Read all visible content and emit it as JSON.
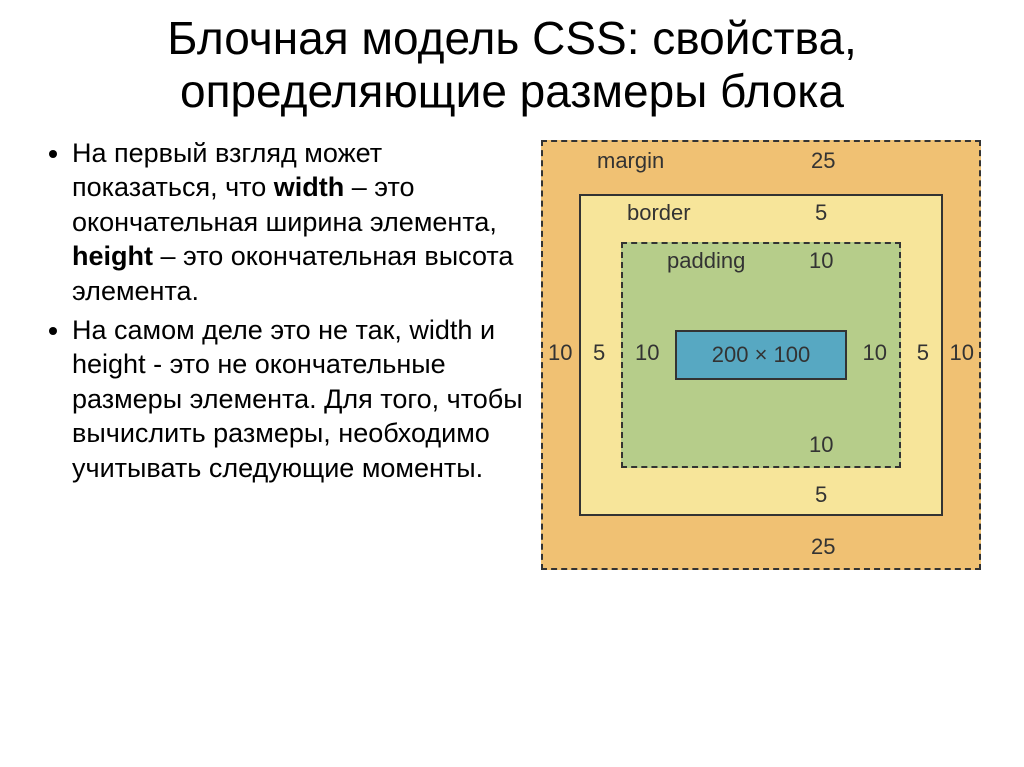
{
  "title": "Блочная модель CSS: свойства, определяющие размеры блока",
  "bullets": {
    "b1a": "На первый взгляд может показаться, что ",
    "b1_width": "width",
    "b1b": " – это окончательная ширина элемента, ",
    "b1_height": "height",
    "b1c": " – это окончательная высота элемента.",
    "b2a": "На самом деле это не так, ",
    "b2_width": "width",
    "b2b": " и ",
    "b2_height": "height",
    "b2c": " - это не окончательные размеры элемента. Для того, чтобы вычислить размеры, необходимо учитывать следующие моменты."
  },
  "diagram": {
    "margin_label": "margin",
    "border_label": "border",
    "padding_label": "padding",
    "content_label": "200 × 100",
    "margin_top": "25",
    "margin_bottom": "25",
    "margin_left": "10",
    "margin_right": "10",
    "border_top": "5",
    "border_bottom": "5",
    "border_left": "5",
    "border_right": "5",
    "padding_top": "10",
    "padding_bottom": "10",
    "padding_left": "10",
    "padding_right": "10"
  }
}
